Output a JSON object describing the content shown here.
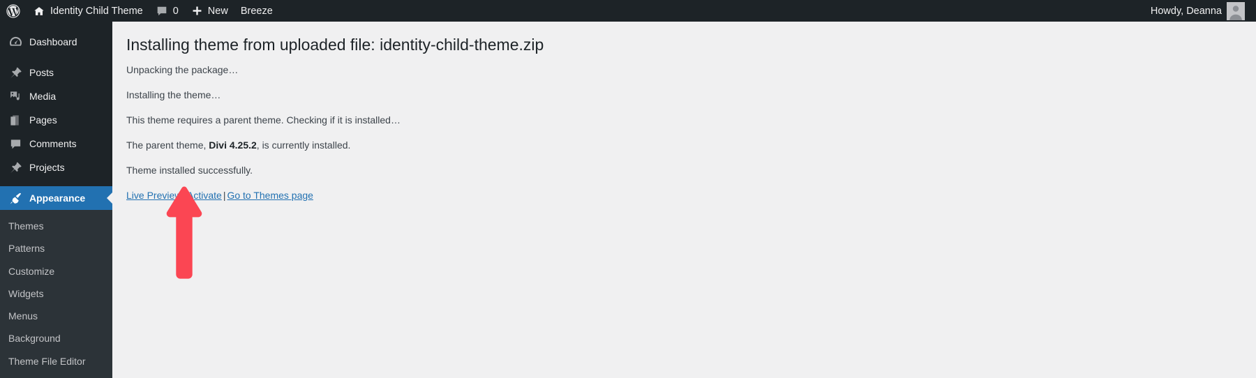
{
  "adminbar": {
    "logo_icon": "wordpress-logo-icon",
    "home_icon": "home-icon",
    "site_name": "Identity Child Theme",
    "comments_icon": "comment-bubble-icon",
    "comments_count": "0",
    "new_icon": "plus-icon",
    "new_label": "New",
    "breeze_label": "Breeze",
    "howdy": "Howdy, Deanna",
    "avatar_icon": "user-avatar-icon"
  },
  "sidebar": {
    "items": [
      {
        "label": "Dashboard",
        "icon": "dashboard-icon",
        "current": false
      },
      {
        "label": "Posts",
        "icon": "pin-icon",
        "current": false
      },
      {
        "label": "Media",
        "icon": "media-icon",
        "current": false
      },
      {
        "label": "Pages",
        "icon": "pages-icon",
        "current": false
      },
      {
        "label": "Comments",
        "icon": "comment-bubble-icon",
        "current": false
      },
      {
        "label": "Projects",
        "icon": "pin-icon",
        "current": false
      },
      {
        "label": "Appearance",
        "icon": "paintbrush-icon",
        "current": true
      }
    ],
    "submenu": [
      {
        "label": "Themes"
      },
      {
        "label": "Patterns"
      },
      {
        "label": "Customize"
      },
      {
        "label": "Widgets"
      },
      {
        "label": "Menus"
      },
      {
        "label": "Background"
      },
      {
        "label": "Theme File Editor"
      }
    ]
  },
  "main": {
    "title": "Installing theme from uploaded file: identity-child-theme.zip",
    "lines": [
      {
        "pre": "Unpacking the package…",
        "bold": "",
        "post": ""
      },
      {
        "pre": "Installing the theme…",
        "bold": "",
        "post": ""
      },
      {
        "pre": "This theme requires a parent theme. Checking if it is installed…",
        "bold": "",
        "post": ""
      },
      {
        "pre": "The parent theme, ",
        "bold": "Divi 4.25.2",
        "post": ", is currently installed."
      },
      {
        "pre": "Theme installed successfully.",
        "bold": "",
        "post": ""
      }
    ],
    "actions": {
      "live_preview": "Live Preview",
      "separator": "|",
      "activate": "Activate",
      "go_to_themes": "Go to Themes page"
    }
  },
  "annotation": {
    "arrow_name": "red-up-arrow-annotation",
    "color": "#fb4653",
    "points_at": "Activate"
  },
  "colors": {
    "adminbar_bg": "#1d2327",
    "sidebar_bg": "#1d2327",
    "submenu_bg": "#2c3338",
    "current_highlight": "#2271b1",
    "content_bg": "#f0f0f1",
    "link": "#2271b1",
    "arrow_red": "#fb4653"
  }
}
